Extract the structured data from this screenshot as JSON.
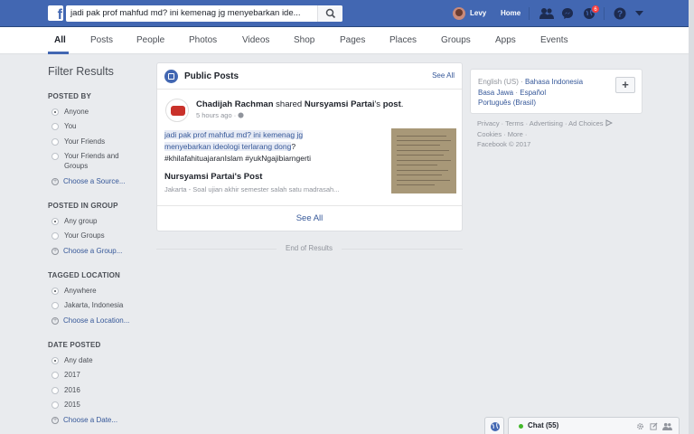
{
  "topbar": {
    "search_value": "jadi pak prof mahfud md? ini kemenag jg menyebarkan ide...",
    "user_name": "Levy",
    "home_label": "Home",
    "notification_count": "6"
  },
  "tabs": [
    "All",
    "Posts",
    "People",
    "Photos",
    "Videos",
    "Shop",
    "Pages",
    "Places",
    "Groups",
    "Apps",
    "Events"
  ],
  "filters": {
    "title": "Filter Results",
    "posted_by": {
      "title": "POSTED BY",
      "options": [
        "Anyone",
        "You",
        "Your Friends",
        "Your Friends and Groups"
      ],
      "choose": "Choose a Source..."
    },
    "posted_in_group": {
      "title": "POSTED IN GROUP",
      "options": [
        "Any group",
        "Your Groups"
      ],
      "choose": "Choose a Group..."
    },
    "tagged_location": {
      "title": "TAGGED LOCATION",
      "options": [
        "Anywhere",
        "Jakarta, Indonesia"
      ],
      "choose": "Choose a Location..."
    },
    "date_posted": {
      "title": "DATE POSTED",
      "options": [
        "Any date",
        "2017",
        "2016",
        "2015"
      ],
      "choose": "Choose a Date..."
    }
  },
  "results": {
    "section_title": "Public Posts",
    "see_all_top": "See All",
    "post": {
      "author": "Chadijah Rachman",
      "action": " shared ",
      "shared_from": "Nursyamsi Partai",
      "suffix_a": "'s ",
      "suffix_b": "post",
      "suffix_c": ".",
      "time": "5 hours ago · ",
      "text_highlight_1": "jadi pak prof mahfud md? ini kemenag jg",
      "text_highlight_2": "menyebarkan ideologi terlarang dong",
      "text_after": "?",
      "hashtags": "#khilafahituajaranIslam #yukNgajibiarngerti",
      "shared_title": "Nursyamsi Partai's Post",
      "shared_subtitle": "Jakarta - Soal ujian akhir semester salah satu madrasah..."
    },
    "see_all_bottom": "See All",
    "end_of_results": "End of Results"
  },
  "right": {
    "current_lang": "English (US)",
    "langs": [
      "Bahasa Indonesia",
      "Basa Jawa",
      "Español",
      "Português (Brasil)"
    ],
    "plus": "+",
    "footer_line1": "Privacy · Terms · Advertising · Ad Choices",
    "footer_line2": "Cookies · More ·",
    "footer_line3": "Facebook © 2017"
  },
  "chat": {
    "label": "Chat (55)"
  },
  "colors": {
    "brand": "#4267b2",
    "link": "#365899",
    "background": "#e9ebee"
  }
}
